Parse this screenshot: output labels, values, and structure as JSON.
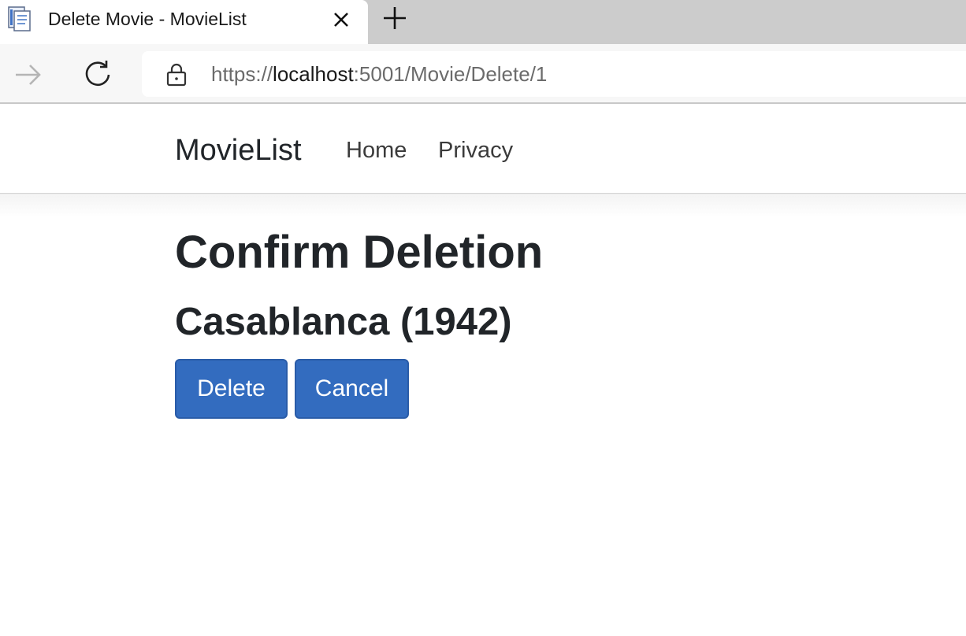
{
  "browser": {
    "tab": {
      "title": "Delete Movie - MovieList"
    },
    "address": {
      "scheme": "https://",
      "host": "localhost",
      "rest": ":5001/Movie/Delete/1"
    },
    "icons": {
      "favicon": "document-icon",
      "close": "close-icon",
      "new_tab": "plus-icon",
      "forward": "arrow-right-icon",
      "refresh": "refresh-icon",
      "lock": "lock-icon"
    }
  },
  "navbar": {
    "brand": "MovieList",
    "links": [
      {
        "label": "Home"
      },
      {
        "label": "Privacy"
      }
    ]
  },
  "main": {
    "heading": "Confirm Deletion",
    "subheading": "Casablanca (1942)",
    "buttons": {
      "delete": "Delete",
      "cancel": "Cancel"
    }
  },
  "colors": {
    "button_primary": "#336cbf",
    "tabstrip": "#cccccc",
    "toolbar": "#f7f7f7"
  }
}
